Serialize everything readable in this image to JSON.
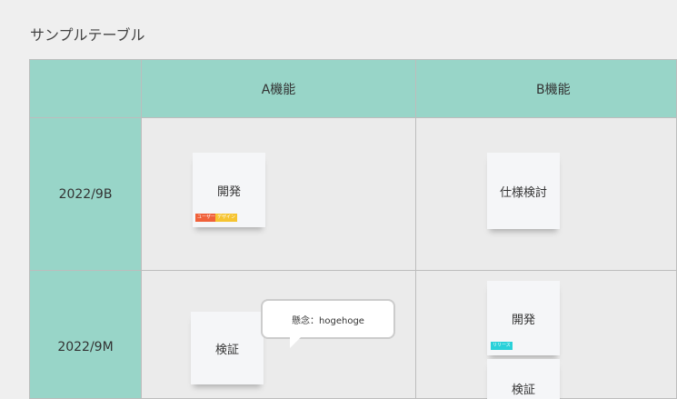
{
  "title": "サンプルテーブル",
  "columns": [
    "",
    "A機能",
    "B機能"
  ],
  "rows": [
    "2022/9B",
    "2022/9M"
  ],
  "notes": {
    "r1a": {
      "label": "開発",
      "tags": [
        {
          "text": "ユーザー",
          "color": "#f0613a"
        },
        {
          "text": "デザイン",
          "color": "#f6c431"
        }
      ]
    },
    "r1b": {
      "label": "仕様検討"
    },
    "r2a": {
      "label": "検証"
    },
    "r2b1": {
      "label": "開発",
      "tags": [
        {
          "text": "リリース",
          "color": "#2ad1d9"
        }
      ]
    },
    "r2b2": {
      "label": "検証"
    }
  },
  "comment": "懸念：hogehoge"
}
